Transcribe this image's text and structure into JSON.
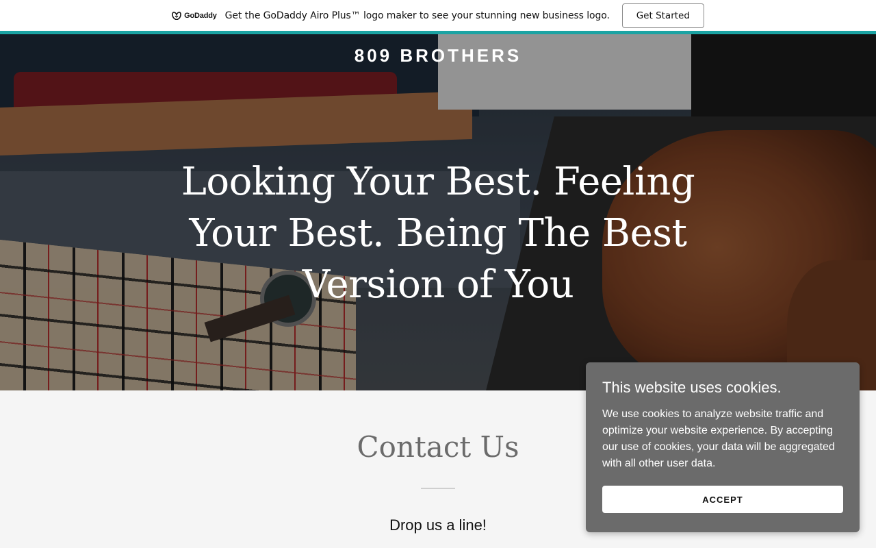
{
  "promo": {
    "logo_text": "GoDaddy",
    "message": "Get the GoDaddy Airo Plus™ logo maker to see your stunning new business logo.",
    "cta_label": "Get Started"
  },
  "hero": {
    "brand": "809 BROTHERS",
    "headline": "Looking Your Best. Feeling Your Best. Being The Best Version of You"
  },
  "contact": {
    "title": "Contact Us",
    "subtitle": "Drop us a line!"
  },
  "cookie": {
    "title": "This website uses cookies.",
    "body": "We use cookies to analyze website traffic and optimize your website experience. By accepting our use of cookies, your data will be aggregated with all other user data.",
    "accept_label": "ACCEPT"
  },
  "colors": {
    "accent": "#1ba3a3",
    "cookie_bg": "#6b6b6b",
    "page_bg": "#f5f5f5"
  }
}
